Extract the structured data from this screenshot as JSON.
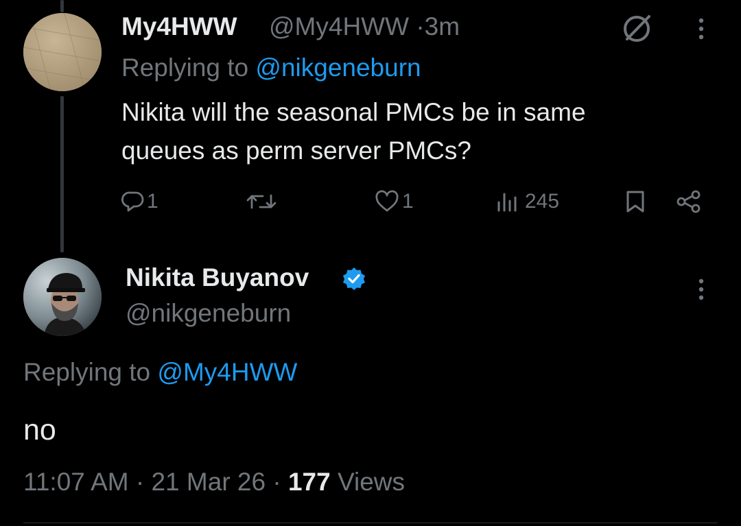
{
  "reply_tweet": {
    "display_name": "My4HWW",
    "handle": "@My4HWW",
    "separator": "·",
    "time_ago": "3m",
    "replying_prefix": "Replying to",
    "replying_to": "@nikgeneburn",
    "text_line1": "Nikita will the seasonal PMCs be in same",
    "text_line2": "queues as perm server PMCs?",
    "actions": {
      "reply_count": "1",
      "retweet_count": "",
      "like_count": "1",
      "view_count": "245"
    },
    "icons": [
      "grok-icon",
      "more-options-icon",
      "reply-icon",
      "retweet-icon",
      "like-icon",
      "views-icon",
      "bookmark-icon",
      "share-icon"
    ]
  },
  "main_tweet": {
    "display_name": "Nikita Buyanov",
    "handle": "@nikgeneburn",
    "replying_prefix": "Replying to",
    "replying_to": "@My4HWW",
    "text": "no",
    "time": "11:07 AM",
    "sep1": "·",
    "date": "21 Mar 26",
    "sep2": "·",
    "views_count": "177",
    "views_label": "Views",
    "icons": [
      "verified-badge-icon",
      "more-options-icon"
    ]
  },
  "colors": {
    "background": "#000000",
    "primary_text": "#e7e9ea",
    "secondary_text": "#71767b",
    "link": "#1d9bf0",
    "verified": "#1d9bf0",
    "thread_line": "#333639"
  }
}
